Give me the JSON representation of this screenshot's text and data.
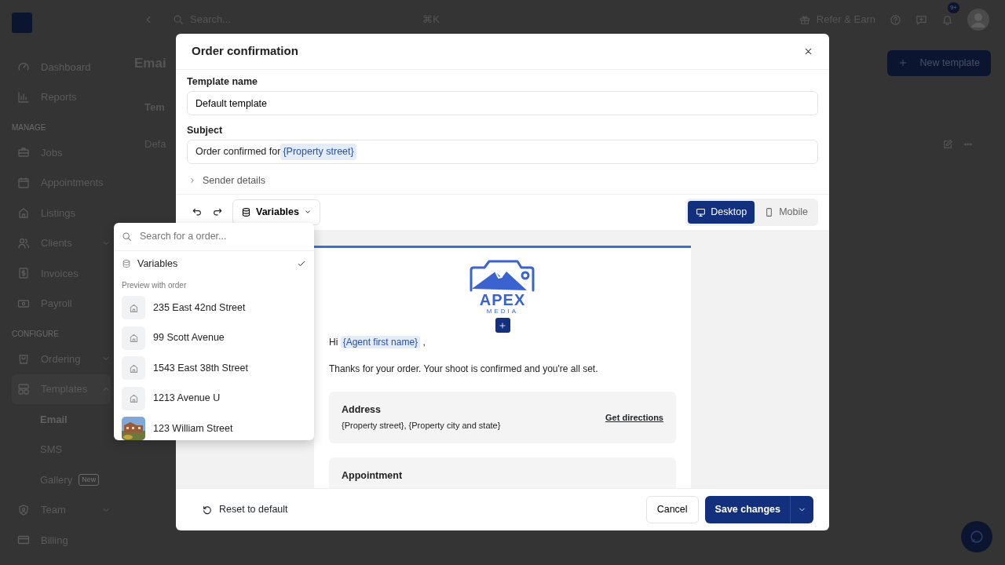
{
  "sidebar": {
    "items": [
      {
        "kind": "item",
        "label": "Dashboard",
        "selected": false
      },
      {
        "kind": "item",
        "label": "Reports",
        "selected": false
      },
      {
        "kind": "section",
        "label": "MANAGE"
      },
      {
        "kind": "item",
        "label": "Jobs",
        "selected": false
      },
      {
        "kind": "item",
        "label": "Appointments",
        "selected": false
      },
      {
        "kind": "item",
        "label": "Listings",
        "selected": false
      },
      {
        "kind": "item",
        "label": "Clients",
        "selected": false,
        "expanded": false
      },
      {
        "kind": "item",
        "label": "Invoices",
        "selected": false
      },
      {
        "kind": "item",
        "label": "Payroll",
        "selected": false
      },
      {
        "kind": "section",
        "label": "CONFIGURE"
      },
      {
        "kind": "item",
        "label": "Ordering",
        "selected": false,
        "expanded": false
      },
      {
        "kind": "item",
        "label": "Templates",
        "selected": false,
        "expanded": true,
        "children": [
          {
            "label": "Email",
            "selected": true
          },
          {
            "label": "SMS",
            "selected": false
          },
          {
            "label": "Gallery",
            "selected": false,
            "badge": "New"
          }
        ]
      },
      {
        "kind": "item",
        "label": "Team",
        "selected": false,
        "expanded": false
      },
      {
        "kind": "item",
        "label": "Billing",
        "selected": false
      }
    ]
  },
  "topbar": {
    "search_placeholder": "Search...",
    "shortcut": "⌘K",
    "refer": "Refer & Earn",
    "notification_count": "9+"
  },
  "page": {
    "title": "Emai",
    "new_button": "New template",
    "table_header": "Tem",
    "table_row": "Defa"
  },
  "modal": {
    "title": "Order confirmation",
    "template_name": {
      "label": "Template name",
      "value": "Default template"
    },
    "subject": {
      "label": "Subject",
      "text": "Order confirmed for ",
      "variable": "{Property street}"
    },
    "sender_details": {
      "label": "Sender details",
      "expanded": false
    },
    "variables_button": "Variables",
    "view_modes": [
      {
        "label": "Desktop",
        "selected": true
      },
      {
        "label": "Mobile",
        "selected": false
      }
    ],
    "email": {
      "logo_title": "APEX",
      "logo_subtitle": "MEDIA",
      "greeting": "Hi",
      "greeting_variable": "{Agent first name}",
      "greeting_end": ",",
      "paragraph": "Thanks for your order. Your shoot is confirmed and you're all set.",
      "cards": [
        {
          "title": "Address",
          "text": "{Property street}, {Property city and state}",
          "link": "Get directions"
        },
        {
          "title": "Appointment"
        }
      ]
    },
    "footer": {
      "reset": "Reset to default",
      "cancel": "Cancel",
      "save": "Save changes"
    }
  },
  "popover": {
    "search_placeholder": "Search for a order...",
    "options": [
      {
        "label": "Variables",
        "selected": true
      }
    ],
    "section": "Preview with order",
    "orders": [
      {
        "kind": "house",
        "label": "235 East 42nd Street"
      },
      {
        "kind": "house",
        "label": "99 Scott Avenue"
      },
      {
        "kind": "house",
        "label": "1543 East 38th Street"
      },
      {
        "kind": "house",
        "label": "1213 Avenue U"
      },
      {
        "kind": "picture",
        "label": "123 William Street"
      }
    ]
  }
}
